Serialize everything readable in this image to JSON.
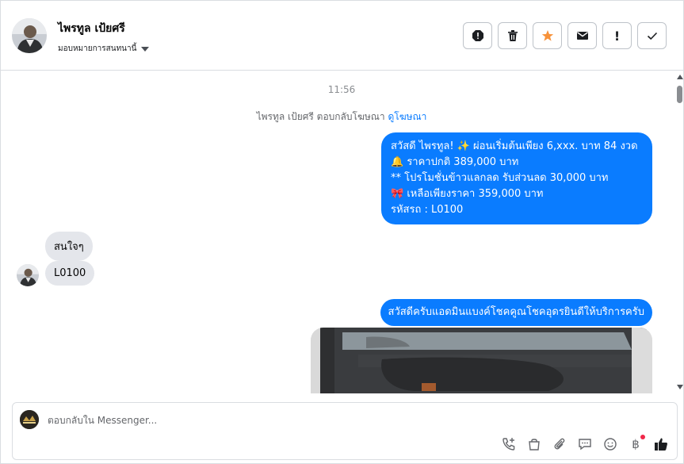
{
  "header": {
    "contact_name": "ไพรทูล เป้ยศรี",
    "assign_label": "มอบหมายการสนทนานี้",
    "actions": [
      {
        "name": "report-spam-icon"
      },
      {
        "name": "trash-icon"
      },
      {
        "name": "star-icon"
      },
      {
        "name": "envelope-icon"
      },
      {
        "name": "mark-important",
        "label": "!"
      },
      {
        "name": "checkmark-icon"
      }
    ],
    "star_color": "#f7923a"
  },
  "thread": {
    "time": "11:56",
    "reply_note": "ไพรทูล เป้ยศรี ตอบกลับโฆษณา",
    "reply_link": "ดูโฆษณา",
    "outgoing_main": {
      "lines": [
        "สวัสดี ไพรทูล! ✨  ผ่อนเริ่มต้นเพียง 6,xxx. บาท 84 งวด",
        "🔔 ราคาปกติ  389,000 บาท",
        "** โปรโมชั่นข้าวแลกลด รับส่วนลด 30,000 บาท",
        "🎀  เหลือเพียงราคา 359,000 บาท",
        " รหัสรถ : L0100"
      ]
    },
    "incoming": [
      {
        "text": "สนใจๆ"
      },
      {
        "text": "L0100"
      }
    ],
    "outgoing_second": "สวัสดีครับแอดมินแบงค์โชคคูณโชคอุดรยินดีให้บริการครับ",
    "bubble_out_color": "#0a7cff",
    "bubble_in_color": "#e4e6eb"
  },
  "composer": {
    "placeholder": "ตอบกลับใน Messenger...",
    "value": "",
    "tools": [
      "phone-add-icon",
      "shopping-bag-icon",
      "paperclip-icon",
      "chat-icon",
      "emoji-icon",
      "baht-icon",
      "thumbs-up-icon"
    ],
    "baht_symbol": "฿"
  }
}
